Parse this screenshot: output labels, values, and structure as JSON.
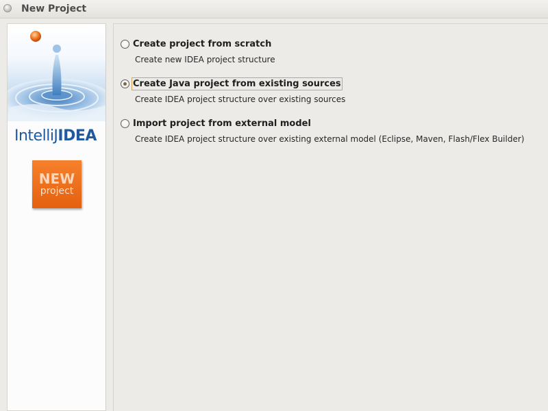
{
  "window": {
    "title": "New Project"
  },
  "sidebar": {
    "logo_part1": "IntelliJ",
    "logo_part2": "IDEA",
    "badge_line1": "NEW",
    "badge_line2": "project"
  },
  "options": [
    {
      "label": "Create project from scratch",
      "description": "Create new IDEA project structure",
      "selected": false
    },
    {
      "label": "Create Java project from existing sources",
      "description": "Create IDEA project structure over existing sources",
      "selected": true
    },
    {
      "label": "Import project from external model",
      "description": "Create IDEA project structure over existing external model (Eclipse, Maven, Flash/Flex Builder)",
      "selected": false
    }
  ],
  "colors": {
    "accent_orange": "#f07a24",
    "logo_blue": "#1f5aa0",
    "focus_border": "#d8a254"
  }
}
